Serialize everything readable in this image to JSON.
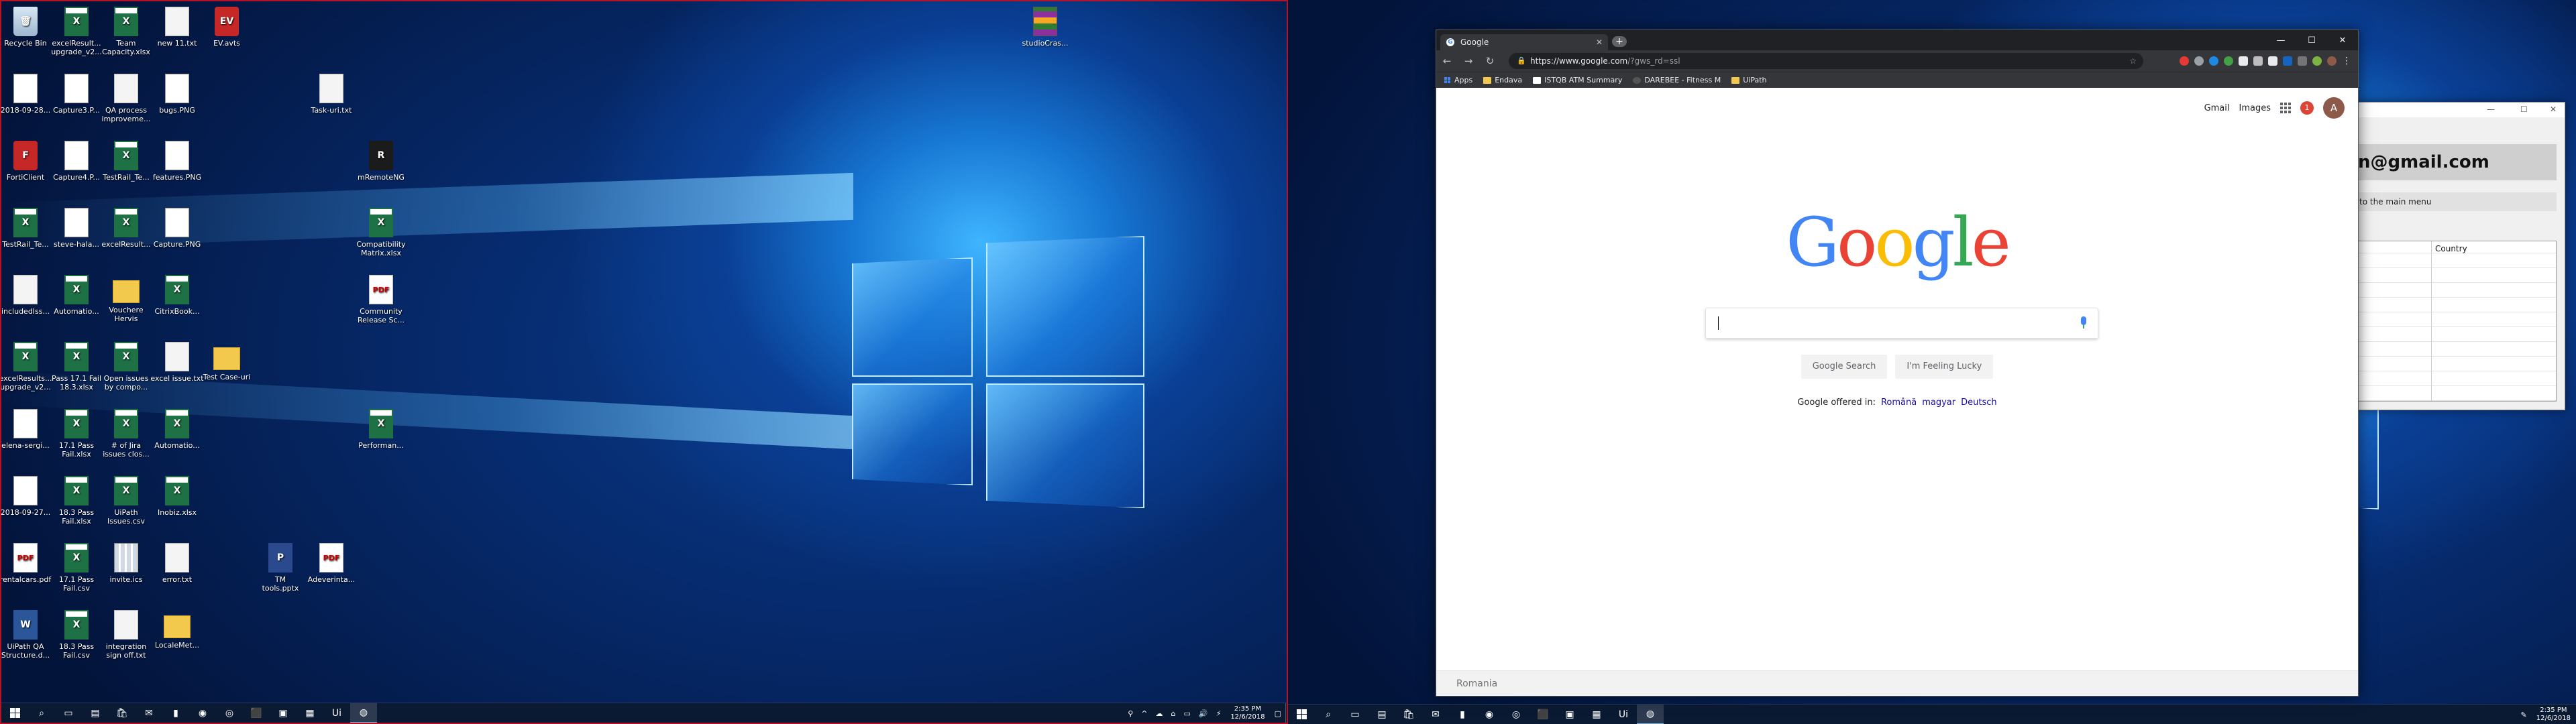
{
  "desktop": {
    "icons": [
      {
        "label": "Recycle Bin",
        "type": "bin",
        "glyph": "🗑"
      },
      {
        "label": "excelResult...\nupgrade_v2...",
        "type": "excel",
        "glyph": "X"
      },
      {
        "label": "Team\nCapacity.xlsx",
        "type": "excel",
        "glyph": "X"
      },
      {
        "label": "new 11.txt",
        "type": "txt",
        "glyph": ""
      },
      {
        "label": "EV.avts",
        "type": "app",
        "glyph": "EV"
      },
      {
        "label": "studioCras...",
        "type": "rar",
        "glyph": ""
      },
      {
        "label": "2018-09-28...",
        "type": "png",
        "glyph": ""
      },
      {
        "label": "Capture3.P...",
        "type": "png",
        "glyph": ""
      },
      {
        "label": "QA process\nimproveme...",
        "type": "txt",
        "glyph": ""
      },
      {
        "label": "bugs.PNG",
        "type": "png",
        "glyph": ""
      },
      {
        "label": "Task-uri.txt",
        "type": "txt",
        "glyph": ""
      },
      {
        "label": "FortiClient",
        "type": "app",
        "glyph": "F"
      },
      {
        "label": "Capture4.P...",
        "type": "png",
        "glyph": ""
      },
      {
        "label": "TestRail_Te...",
        "type": "excel",
        "glyph": "X"
      },
      {
        "label": "features.PNG",
        "type": "png",
        "glyph": ""
      },
      {
        "label": "mRemoteNG",
        "type": "mr",
        "glyph": "R"
      },
      {
        "label": "TestRail_Te...",
        "type": "excel",
        "glyph": "X"
      },
      {
        "label": "steve-hala...",
        "type": "png",
        "glyph": ""
      },
      {
        "label": "excelResult...",
        "type": "excel",
        "glyph": "X"
      },
      {
        "label": "Capture.PNG",
        "type": "png",
        "glyph": ""
      },
      {
        "label": "Compatibility\nMatrix.xlsx",
        "type": "excel",
        "glyph": "X"
      },
      {
        "label": "includedIss...",
        "type": "txt",
        "glyph": ""
      },
      {
        "label": "Automatio...",
        "type": "excel",
        "glyph": "X"
      },
      {
        "label": "Vouchere\nHervis",
        "type": "folder",
        "glyph": ""
      },
      {
        "label": "CitrixBook...",
        "type": "excel",
        "glyph": "X"
      },
      {
        "label": "Community\nRelease Sc...",
        "type": "pdf",
        "glyph": "PDF"
      },
      {
        "label": "excelResults...\nupgrade_v2...",
        "type": "excel",
        "glyph": "X"
      },
      {
        "label": "Pass 17.1 Fail\n18.3.xlsx",
        "type": "excel",
        "glyph": "X"
      },
      {
        "label": "Open issues\nby compo...",
        "type": "excel",
        "glyph": "X"
      },
      {
        "label": "excel issue.txt",
        "type": "txt",
        "glyph": ""
      },
      {
        "label": "Test Case-uri",
        "type": "folder",
        "glyph": ""
      },
      {
        "label": "elena-sergi...",
        "type": "png",
        "glyph": ""
      },
      {
        "label": "17.1 Pass\nFail.xlsx",
        "type": "excel",
        "glyph": "X"
      },
      {
        "label": "# of Jira\nissues clos...",
        "type": "excel",
        "glyph": "X"
      },
      {
        "label": "Automatio...",
        "type": "excel",
        "glyph": "X"
      },
      {
        "label": "Performan...",
        "type": "excel",
        "glyph": "X"
      },
      {
        "label": "2018-09-27...",
        "type": "png",
        "glyph": ""
      },
      {
        "label": "18.3 Pass\nFail.xlsx",
        "type": "excel",
        "glyph": "X"
      },
      {
        "label": "UiPath\nIssues.csv",
        "type": "excel",
        "glyph": "X"
      },
      {
        "label": "Inobiz.xlsx",
        "type": "excel",
        "glyph": "X"
      },
      {
        "label": "rentalcars.pdf",
        "type": "pdf",
        "glyph": "PDF"
      },
      {
        "label": "17.1 Pass\nFail.csv",
        "type": "excel",
        "glyph": "X"
      },
      {
        "label": "invite.ics",
        "type": "ics",
        "glyph": ""
      },
      {
        "label": "error.txt",
        "type": "txt",
        "glyph": ""
      },
      {
        "label": "TM\ntools.pptx",
        "type": "ppt",
        "glyph": "P"
      },
      {
        "label": "Adeverinta...",
        "type": "pdf",
        "glyph": "PDF"
      },
      {
        "label": "UiPath QA\nStructure.d...",
        "type": "word",
        "glyph": "W"
      },
      {
        "label": "18.3 Pass\nFail.csv",
        "type": "excel",
        "glyph": "X"
      },
      {
        "label": "integration\nsign off.txt",
        "type": "txt",
        "glyph": ""
      },
      {
        "label": "LocaleMet...",
        "type": "folder",
        "glyph": ""
      }
    ]
  },
  "taskbar_left": {
    "apps": [
      "⌕",
      "▭",
      "▤",
      "🛍",
      "✉",
      "▮",
      "◉",
      "◎",
      "⬛",
      "▣",
      "▦",
      "Ui",
      "◍"
    ],
    "tray": [
      "⚲",
      "^",
      "☁",
      "⌂",
      "▭",
      "🔊",
      "⚡"
    ],
    "time": "2:35 PM",
    "date": "12/6/2018"
  },
  "taskbar_right": {
    "apps": [
      "⌕",
      "▭",
      "▤",
      "🛍",
      "✉",
      "▮",
      "◉",
      "◎",
      "⬛",
      "▣",
      "▦",
      "Ui",
      "◍"
    ],
    "time": "2:35 PM",
    "date": "12/6/2018"
  },
  "chrome": {
    "tab_title": "Google",
    "tab_favicon": "G",
    "new_tab": "+",
    "url_host": "https://www.google.com",
    "url_path": "/?gws_rd=ssl",
    "bookmarks": [
      "Apps",
      "Endava",
      "ISTQB ATM Summary",
      "DAREBEE - Fitness M",
      "UiPath"
    ],
    "top_links": {
      "gmail": "Gmail",
      "images": "Images",
      "notifications": "1",
      "avatar": "A"
    },
    "logo_letters": [
      {
        "ch": "G",
        "color": "#4285f4"
      },
      {
        "ch": "o",
        "color": "#ea4335"
      },
      {
        "ch": "o",
        "color": "#fbbc05"
      },
      {
        "ch": "g",
        "color": "#4285f4"
      },
      {
        "ch": "l",
        "color": "#34a853"
      },
      {
        "ch": "e",
        "color": "#ea4335"
      }
    ],
    "search_button": "Google Search",
    "lucky_button": "I'm Feeling Lucky",
    "offered_in": "Google offered in:",
    "languages": [
      "Română",
      "magyar",
      "Deutsch"
    ],
    "footer_country": "Romania"
  },
  "background_window": {
    "email": "n@gmail.com",
    "hint": "to the main menu",
    "column_header": "Country"
  }
}
